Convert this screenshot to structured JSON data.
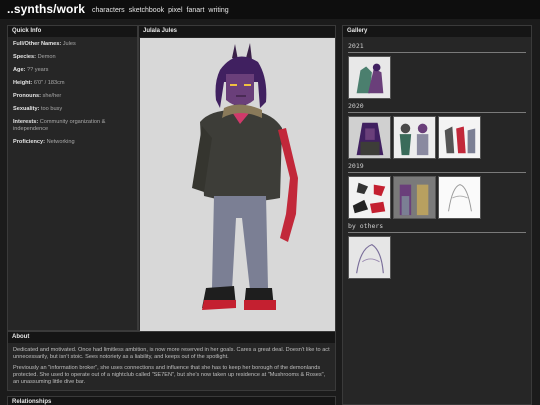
{
  "header": {
    "site_title": "..synths/work",
    "nav": [
      "characters",
      "sketchbook",
      "pixel",
      "fanart",
      "writing"
    ]
  },
  "quick_info": {
    "heading": "Quick Info",
    "rows": [
      {
        "label": "Full/Other Names:",
        "value": "Jules"
      },
      {
        "label": "Species:",
        "value": "Demon"
      },
      {
        "label": "Age:",
        "value": "?? years"
      },
      {
        "label": "Height:",
        "value": "6'0\" / 183cm"
      },
      {
        "label": "Pronouns:",
        "value": "she/her"
      },
      {
        "label": "Sexuality:",
        "value": "too busy"
      },
      {
        "label": "Interests:",
        "value": "Community organization & independence"
      },
      {
        "label": "Proficiency:",
        "value": "Networking"
      }
    ]
  },
  "art": {
    "heading": "Julala Jules"
  },
  "about": {
    "heading": "About",
    "paragraphs": [
      "Dedicated and motivated. Once had limitless ambition, is now more reserved in her goals. Cares a great deal. Doesn't like to act unnecessarily, but isn't stoic. Sees notoriety as a liability, and keeps out of the spotlight.",
      "Previously an \"information broker\", she uses connections and influence that she has to keep her borough of the demonlands protected. She used to operate out of a nightclub called \"SE7EN\", but she's now taken up residence at \"Mushrooms & Roses\", an unassuming little dive bar."
    ]
  },
  "relationships": {
    "heading": "Relationships"
  },
  "gallery": {
    "heading": "Gallery",
    "sections": [
      {
        "label": "2021",
        "count": 1
      },
      {
        "label": "2020",
        "count": 3
      },
      {
        "label": "2019",
        "count": 3
      },
      {
        "label": "by others",
        "count": 1
      }
    ]
  },
  "colors": {
    "background": "#1b1b1b",
    "topbar": "#0e0e0e",
    "panel": "#262626",
    "panel_head": "#151515",
    "skin": "#6a3f7a",
    "hand_red": "#c2283a",
    "jacket": "#3d3d38",
    "jeans": "#7b7f94"
  }
}
